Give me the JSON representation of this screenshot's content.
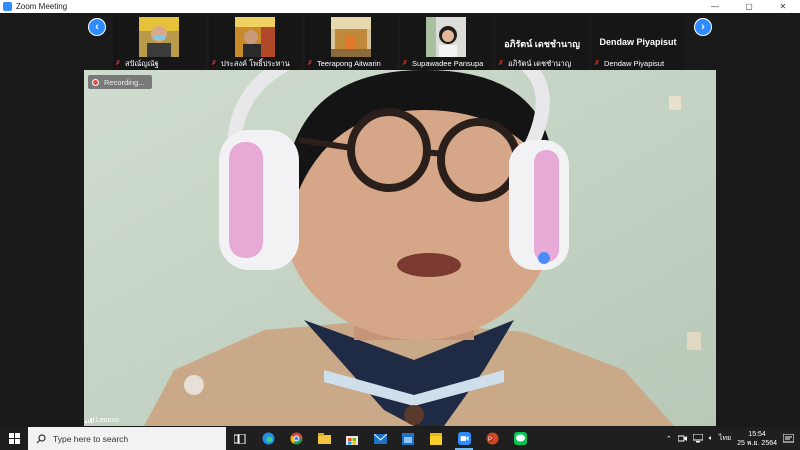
{
  "window": {
    "title": "Zoom Meeting",
    "controls": [
      "—",
      "▢",
      "✕"
    ]
  },
  "gallery": {
    "prev_icon": "chevron-left-icon",
    "next_icon": "chevron-right-icon",
    "participants": [
      {
        "name": "สปัณ์ญณัฐ",
        "video": true,
        "muted": true
      },
      {
        "name": "ประสงค์ โพธิ์ประทาน",
        "video": true,
        "muted": true
      },
      {
        "name": "Teerapong Aitwarin",
        "video": true,
        "muted": true
      },
      {
        "name": "Supawadee Pansupa",
        "video": true,
        "muted": true
      },
      {
        "name": "อภิรัตน์ เดชชำนาญ",
        "display_text": "อภิรัตน์ เดชชำนาญ",
        "video": false,
        "muted": true
      },
      {
        "name": "Dendaw Piyapisut",
        "display_text": "Dendaw Piyapisut",
        "video": false,
        "muted": true
      }
    ]
  },
  "main_video": {
    "recording_label": "Recording...",
    "camera_label": "Lenovo"
  },
  "taskbar": {
    "search_placeholder": "Type here to search",
    "apps": [
      "task-view-icon",
      "edge-icon",
      "chrome-icon",
      "file-explorer-icon",
      "store-icon",
      "mail-icon",
      "calendar-icon",
      "sticky-notes-icon",
      "zoom-icon",
      "powerpoint-icon",
      "line-icon"
    ],
    "active_app": "zoom-icon",
    "language": "ไทย",
    "time": "15:54",
    "date": "25 พ.ย. 2564"
  },
  "colors": {
    "accent": "#2d8cff",
    "muted_mic": "#e23a3a",
    "recording": "#e84a4a"
  }
}
